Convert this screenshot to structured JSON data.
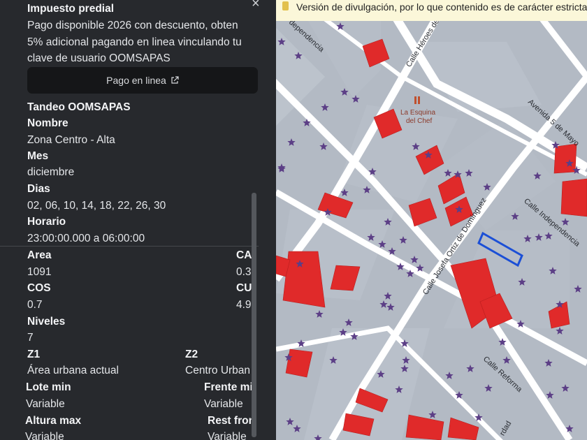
{
  "sidebar": {
    "title": "Impuesto predial",
    "promo_lines": [
      "Pago disponible 2026 con descuento, obten",
      "5% adicional pagando en linea vinculando tu",
      "clave de usuario OOMSAPAS"
    ],
    "pay_button": "Pago en linea",
    "tandeo_title": "Tandeo OOMSAPAS",
    "nombre_label": "Nombre",
    "nombre_value": "Zona Centro - Alta",
    "mes_label": "Mes",
    "mes_value": "diciembre",
    "dias_label": "Dias",
    "dias_value": "02, 06, 10, 14, 18, 22, 26, 30",
    "horario_label": "Horario",
    "horario_value": "23:00:00.000 a 06:00:00",
    "area_label": "Area",
    "area_value": "1091",
    "cas_label": "CA:",
    "cas_value": "0.3",
    "cos_label": "COS",
    "cos_value": "0.7",
    "cus_label": "CU:",
    "cus_value": "4.9",
    "niveles_label": "Niveles",
    "niveles_value": "7",
    "z1_label": "Z1",
    "z1_value": "Área urbana actual",
    "z2_label": "Z2",
    "z2_value": "Centro Urban",
    "lote_label": "Lote min",
    "lote_value": "Variable",
    "frente_label": "Frente mi",
    "frente_value": "Variable",
    "altura_label": "Altura max",
    "altura_value": "Variable",
    "rest_label": "Rest fron",
    "rest_value": "Variable"
  },
  "map": {
    "banner_text": "Versión de divulgación, por lo que contenido es de carácter estrictam",
    "streets": {
      "independencia_top": "dependencia",
      "heroes": "Calle Héroes de",
      "cinco_mayo": "Avenida 5 de Mayo",
      "independencia": "Calle Independencia",
      "ortiz": "Calle Josefa Ortiz de Domínguez",
      "reforma": "Calle Reforma",
      "libertad": "rdad"
    },
    "poi": {
      "line1": "La Esquina",
      "line2": "del Chef"
    },
    "colors": {
      "road": "#ffffff",
      "block": "#b8bfc9",
      "lot": "#a7afba",
      "highlight": "#e02a2a",
      "marker": "#5c3f86",
      "selected": "#1b4fd6"
    }
  }
}
